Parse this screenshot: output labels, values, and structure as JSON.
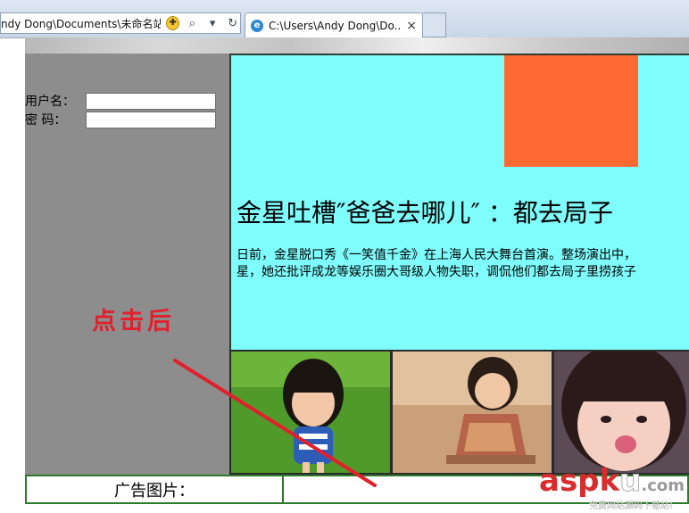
{
  "browser": {
    "address_url": "ndy Dong\\Documents\\未命名站点",
    "tab_title": "C:\\Users\\Andy Dong\\Do...",
    "tab_close": "×",
    "search_glyph": "⌕",
    "dropdown_glyph": "▾",
    "refresh_glyph": "↻",
    "ie_glyph": "e",
    "compat_glyph": "✚"
  },
  "login": {
    "username_label": "用户名：",
    "password_label": "密  码："
  },
  "article": {
    "headline": "金星吐槽″爸爸去哪儿″ ：都去局子",
    "paragraph_line1": "日前，金星脱口秀《一笑值千金》在上海人民大舞台首演。整场演出中，",
    "paragraph_line2": "星，她还批评成龙等娱乐圈大哥级人物失职，调侃他们都去局子里捞孩子"
  },
  "footer": {
    "ad_label": "广告图片："
  },
  "annotation": {
    "text": "点击后"
  },
  "watermark": {
    "logo_part1": "asp",
    "logo_part2": "k",
    "logo_part3": "u",
    "logo_part4": ".com",
    "subtitle": "免费网站源码下载站!"
  },
  "colors": {
    "sidebar": "#8d8d8d",
    "main_bg": "#7ffcfc",
    "orange_block": "#ff6a33",
    "annotation_red": "#e1202c",
    "footer_border": "#2d7a2d"
  }
}
